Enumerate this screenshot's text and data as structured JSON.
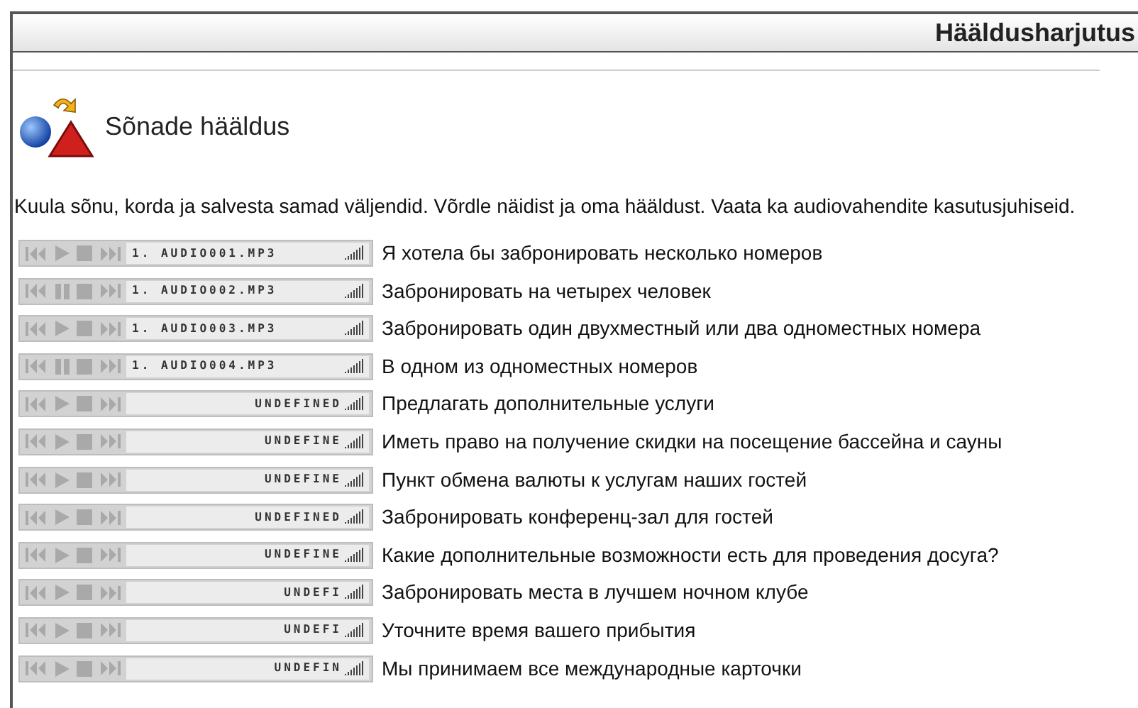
{
  "header": {
    "title": "Hääldusharjutus"
  },
  "section": {
    "title": "Sõnade hääldus",
    "instructions": "Kuula sõnu, korda ja salvesta samad väljendid. Võrdle näidist ja oma hääldust. Vaata ka audiovahendite kasutusjuhiseid."
  },
  "items": [
    {
      "track": "1. AUDIO001.MP3",
      "playing": false,
      "phrase": "Я хотела бы забронировать несколько номеров"
    },
    {
      "track": "1. AUDIO002.MP3",
      "playing": true,
      "phrase": "Забронировать на четырех человек"
    },
    {
      "track": "1. AUDIO003.MP3",
      "playing": false,
      "phrase": "Забронировать один двухместный или два одноместных номера"
    },
    {
      "track": "1. AUDIO004.MP3",
      "playing": true,
      "phrase": "В одном из одноместных номеров"
    },
    {
      "track": "UNDEFINED",
      "playing": false,
      "phrase": "Предлагать дополнительные услуги"
    },
    {
      "track": "UNDEFINE",
      "playing": false,
      "phrase": "Иметь право на получение скидки на посещение бассейна и сауны"
    },
    {
      "track": "UNDEFINE",
      "playing": false,
      "phrase": "Пункт обмена валюты к услугам наших гостей"
    },
    {
      "track": "UNDEFINED",
      "playing": false,
      "phrase": "Забронировать конференц-зал для гостей"
    },
    {
      "track": "UNDEFINE",
      "playing": false,
      "phrase": "Какие дополнительные возможности есть для проведения досуга?"
    },
    {
      "track": "UNDEFI",
      "playing": false,
      "phrase": "Забронировать места в лучшем ночном клубе"
    },
    {
      "track": "UNDEFI",
      "playing": false,
      "phrase": "Уточните время вашего прибытия"
    },
    {
      "track": "UNDEFIN",
      "playing": false,
      "phrase": "Мы принимаем все международные карточки"
    }
  ]
}
